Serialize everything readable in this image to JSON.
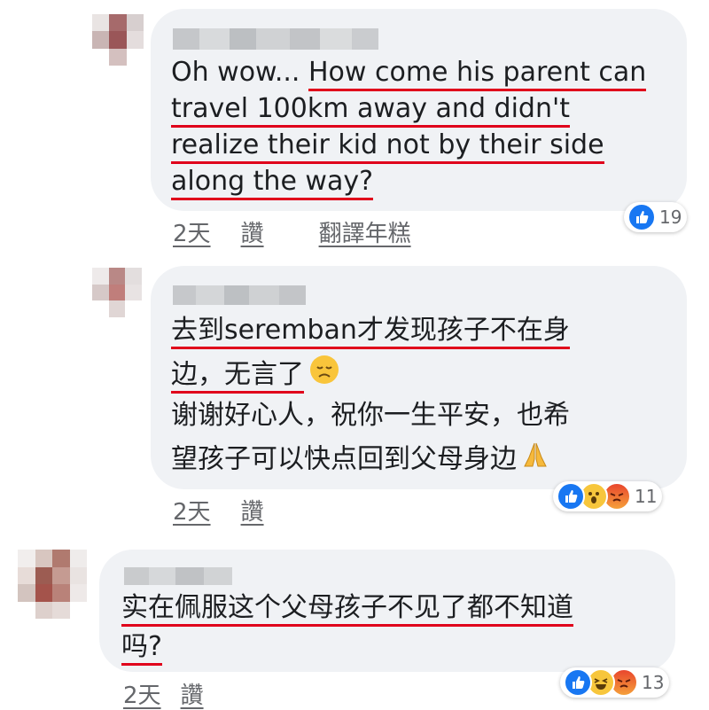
{
  "comments": [
    {
      "lines": [
        [
          "Oh wow... ",
          "How come his parent can"
        ],
        [
          "",
          "travel 100km away and didn't"
        ],
        [
          "",
          "realize their kid not by their side"
        ],
        [
          "",
          "along the way?"
        ]
      ],
      "time": "2天",
      "like": "讚",
      "translate": "翻譯年糕",
      "reaction_count": "19",
      "reaction_icons": [
        "like-icon"
      ]
    },
    {
      "lines": [
        [
          "",
          "去到seremban才发现孩子不在身"
        ],
        [
          "",
          "边，无言了"
        ],
        [
          "谢谢好心人，祝你一生平安，也希",
          ""
        ],
        [
          "望孩子可以快点回到父母身边",
          ""
        ]
      ],
      "time": "2天",
      "like": "讚",
      "reaction_count": "11",
      "reaction_icons": [
        "like-icon",
        "wow-icon",
        "angry-icon"
      ]
    },
    {
      "lines": [
        [
          "",
          "实在佩服这个父母孩子不见了都不知道"
        ],
        [
          "",
          "吗?"
        ]
      ],
      "time": "2天",
      "like": "讚",
      "reaction_count": "13",
      "reaction_icons": [
        "like-icon",
        "haha-icon",
        "angry-icon"
      ]
    }
  ],
  "colors": {
    "bubble": "#f0f2f5",
    "underline": "#e0001b",
    "meta_text": "#65676b",
    "like_blue": "#1877f2"
  }
}
